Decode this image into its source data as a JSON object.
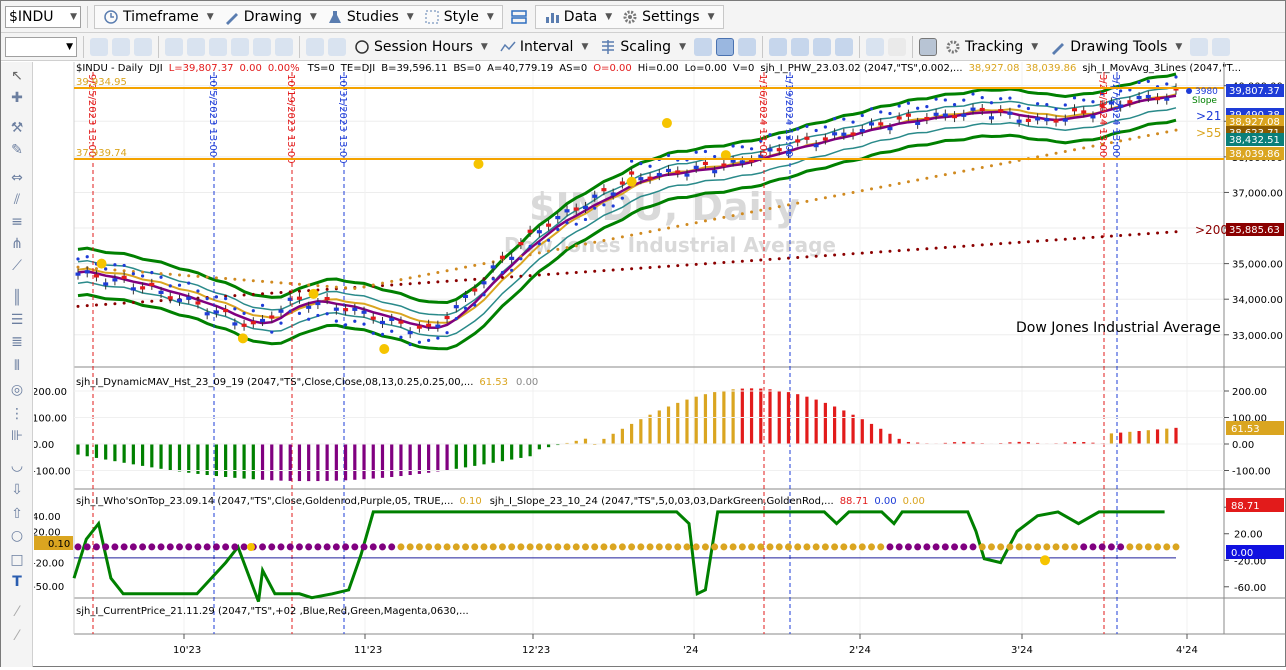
{
  "toolbar1": {
    "symbol": "$INDU",
    "timeframe": "Timeframe",
    "drawing": "Drawing",
    "studies": "Studies",
    "style": "Style",
    "data": "Data",
    "settings": "Settings"
  },
  "toolbar2": {
    "session_hours": "Session Hours",
    "interval": "Interval",
    "scaling": "Scaling",
    "tracking": "Tracking",
    "drawing_tools": "Drawing Tools"
  },
  "header": {
    "symbol": "$INDU - Daily",
    "exchange": "DJI",
    "L": "L=39,807.37",
    "chg": "0.00",
    "pct": "0.00%",
    "ts": "TS=0",
    "te": "TE=DJI",
    "B": "B=39,596.11",
    "BS": "BS=0",
    "A": "A=40,779.19",
    "AS": "AS=0",
    "O": "O=0.00",
    "Hi": "Hi=0.00",
    "Lo": "Lo=0.00",
    "V": "V=0",
    "study": "sjh_I_PHW_23.03.02 (2047,\"TS\",0.002,...",
    "v1": "38,927.08",
    "v2": "38,039.86",
    "study2": "sjh_I_MovAvg_3Lines (2047,\"T..."
  },
  "watermark": {
    "title": "$INDU, Daily",
    "subtitle": "Dow Jones Industrial Average"
  },
  "main_pane": {
    "side_label": "Dow Jones Industrial Average",
    "hline_top": "39,934.95",
    "hline_bottom": "37,939.74",
    "labels": {
      "l3980": "3980",
      "slope": "Slope",
      "ma21": ">21",
      "ma55": ">55",
      "ma200": ">200"
    },
    "price_badges": [
      "39,807.37",
      "39,490.38",
      "38,927.08",
      "38,623.71",
      "38,432.51",
      "38,039.86",
      "35,885.63"
    ],
    "yticks": [
      "40,000.00",
      "39,000.00",
      "38,000.00",
      "37,000.00",
      "36,000.00",
      "35,000.00",
      "34,000.00",
      "33,000.00"
    ],
    "vlines": [
      "9/25/2023 13:00",
      "10/5/2023 13:00",
      "10/19/2023 13:00",
      "10/31/2023 13:00",
      "1/16/2024 13:00",
      "1/19/2024 13:00",
      "3/21/2024 13:00",
      "3/27/2024 13:00"
    ]
  },
  "pane2": {
    "title": "sjh_I_DynamicMAV_Hst_23_09_19 (2047,\"TS\",Close,Close,08,13,0.25,0.25,00,...",
    "v1": "61.53",
    "v2": "0.00",
    "badge": "61.53",
    "yticks": [
      "200.00",
      "100.00",
      "0.00",
      "-100.00"
    ]
  },
  "pane3": {
    "title1": "sjh_I_Who'sOnTop_23.09.14 (2047,\"TS\",Close,Goldenrod,Purple,05,  TRUE,...",
    "v1": "0.10",
    "title2": "sjh_I_Slope_23_10_24 (2047,\"TS\",5,0,03,03,DarkGreen,GoldenRod,...",
    "v2": "88.71",
    "v3": "0.00",
    "v4": "0.00",
    "badge_left": "0.10",
    "badge_red": "88.71",
    "badge_blue": "0.00",
    "yticks_left": [
      "40.00",
      "20.00",
      "-20.00",
      "-50.00"
    ],
    "yticks_right": [
      "60.00",
      "20.00",
      "-20.00",
      "-60.00"
    ]
  },
  "pane4": {
    "title": "sjh_I_CurrentPrice_21.11.29 (2047,\"TS\",+02 ,Blue,Red,Green,Magenta,0630,..."
  },
  "xaxis": {
    "labels": [
      "10'23",
      "11'23",
      "12'23",
      "'24",
      "2'24",
      "3'24",
      "4'24"
    ]
  },
  "colors": {
    "up": "#1e3cd7",
    "down": "#e21b1b",
    "goldenrod": "#daa520",
    "purple": "#800080",
    "green": "#008000",
    "darkred": "#8b0000",
    "orange": "#ffa500"
  },
  "icons": [
    "pointer-icon",
    "crosshair-icon",
    "wrench-icon",
    "pencil-icon",
    "trendline-icon",
    "hline-icon",
    "vline-icon",
    "fib-icon",
    "text-icon",
    "circle-icon",
    "rectangle-icon",
    "arrow-up-icon",
    "arrow-down-icon"
  ]
}
